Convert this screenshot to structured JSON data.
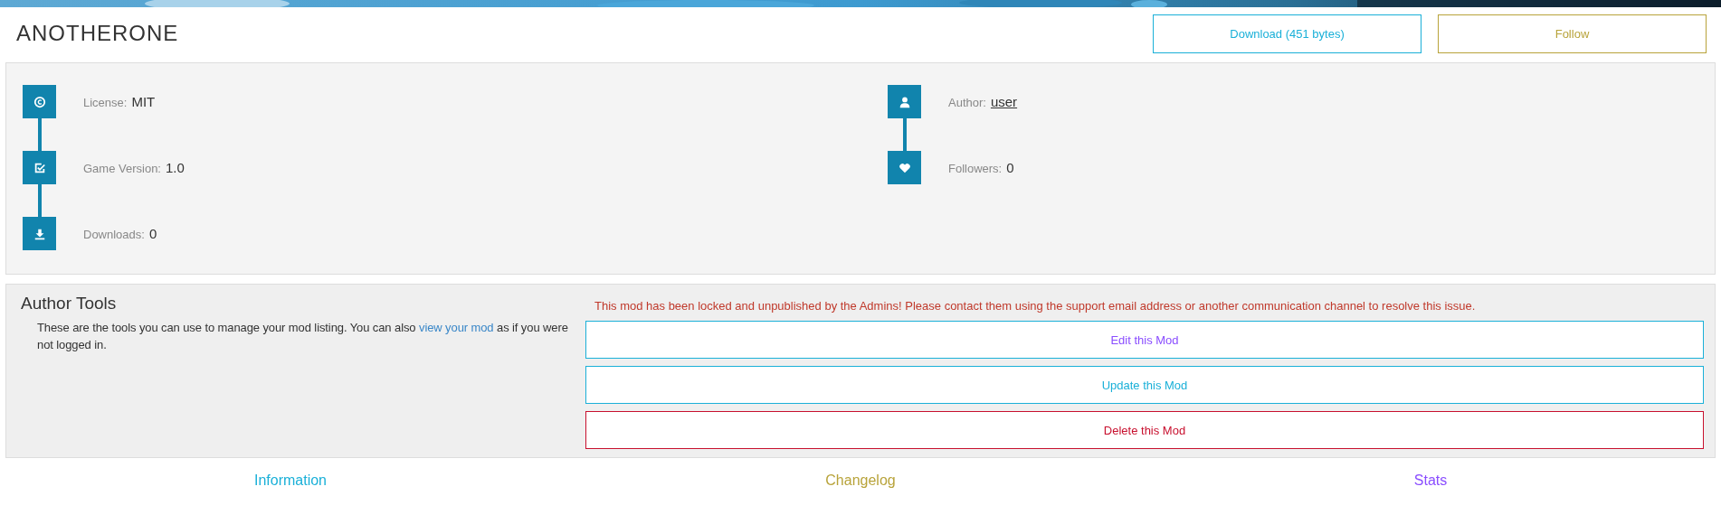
{
  "header": {
    "title": "ANOTHERONE",
    "buttons": [
      {
        "label": "Download (451 bytes)",
        "kind": "download"
      },
      {
        "label": "Follow",
        "kind": "follow"
      }
    ]
  },
  "info": {
    "left": [
      {
        "label": "License:",
        "value": "MIT",
        "kind": "text"
      },
      {
        "label": "Game Version:",
        "value": "1.0",
        "kind": "text"
      },
      {
        "label": "Downloads:",
        "value": "0",
        "kind": "text"
      }
    ],
    "right": [
      {
        "label": "Author:",
        "value": "user",
        "kind": "link"
      },
      {
        "label": "Followers:",
        "value": "0",
        "kind": "text"
      }
    ]
  },
  "author_tools": {
    "title": "Author Tools",
    "description_before": "These are the tools you can use to manage your mod listing. You can also",
    "description_link": "view your mod",
    "description_after": "as if you were not logged in.",
    "warning": "This mod has been locked and unpublished by the Admins! Please contact them using the support email address or another communication channel to resolve this issue.",
    "buttons": [
      {
        "label": "Edit this Mod",
        "kind": "edit"
      },
      {
        "label": "Update this Mod",
        "kind": "update"
      },
      {
        "label": "Delete this Mod",
        "kind": "delete"
      }
    ]
  },
  "tabs": [
    {
      "label": "Information",
      "color": "#1ab0d8"
    },
    {
      "label": "Changelog",
      "color": "#b8a33a"
    },
    {
      "label": "Stats",
      "color": "#8a4dff"
    }
  ]
}
